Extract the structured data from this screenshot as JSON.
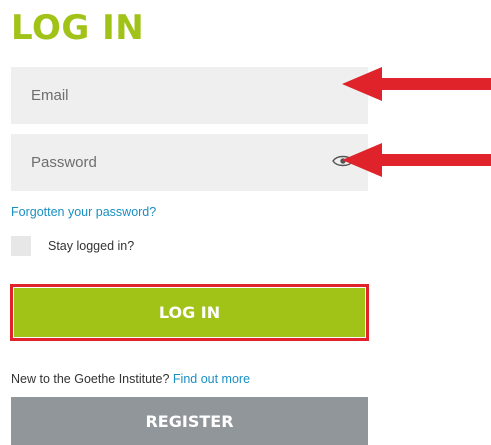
{
  "page": {
    "title": "LOG IN"
  },
  "form": {
    "email_placeholder": "Email",
    "password_placeholder": "Password",
    "forgot_link": "Forgotten your password?",
    "stay_logged_in_label": "Stay logged in?",
    "login_button": "LOG IN"
  },
  "footer": {
    "new_to_text": "New to the Goethe Institute?",
    "find_out_more_link": "Find out more",
    "register_button": "REGISTER"
  },
  "icons": {
    "show_password": "eye-icon",
    "annotation_arrows": "arrow-left-icon"
  },
  "colors": {
    "brand_green": "#a1c217",
    "link_blue": "#1a8fc2",
    "field_bg": "#efefef",
    "register_gray": "#909699",
    "annotation_red": "#e0232a"
  }
}
